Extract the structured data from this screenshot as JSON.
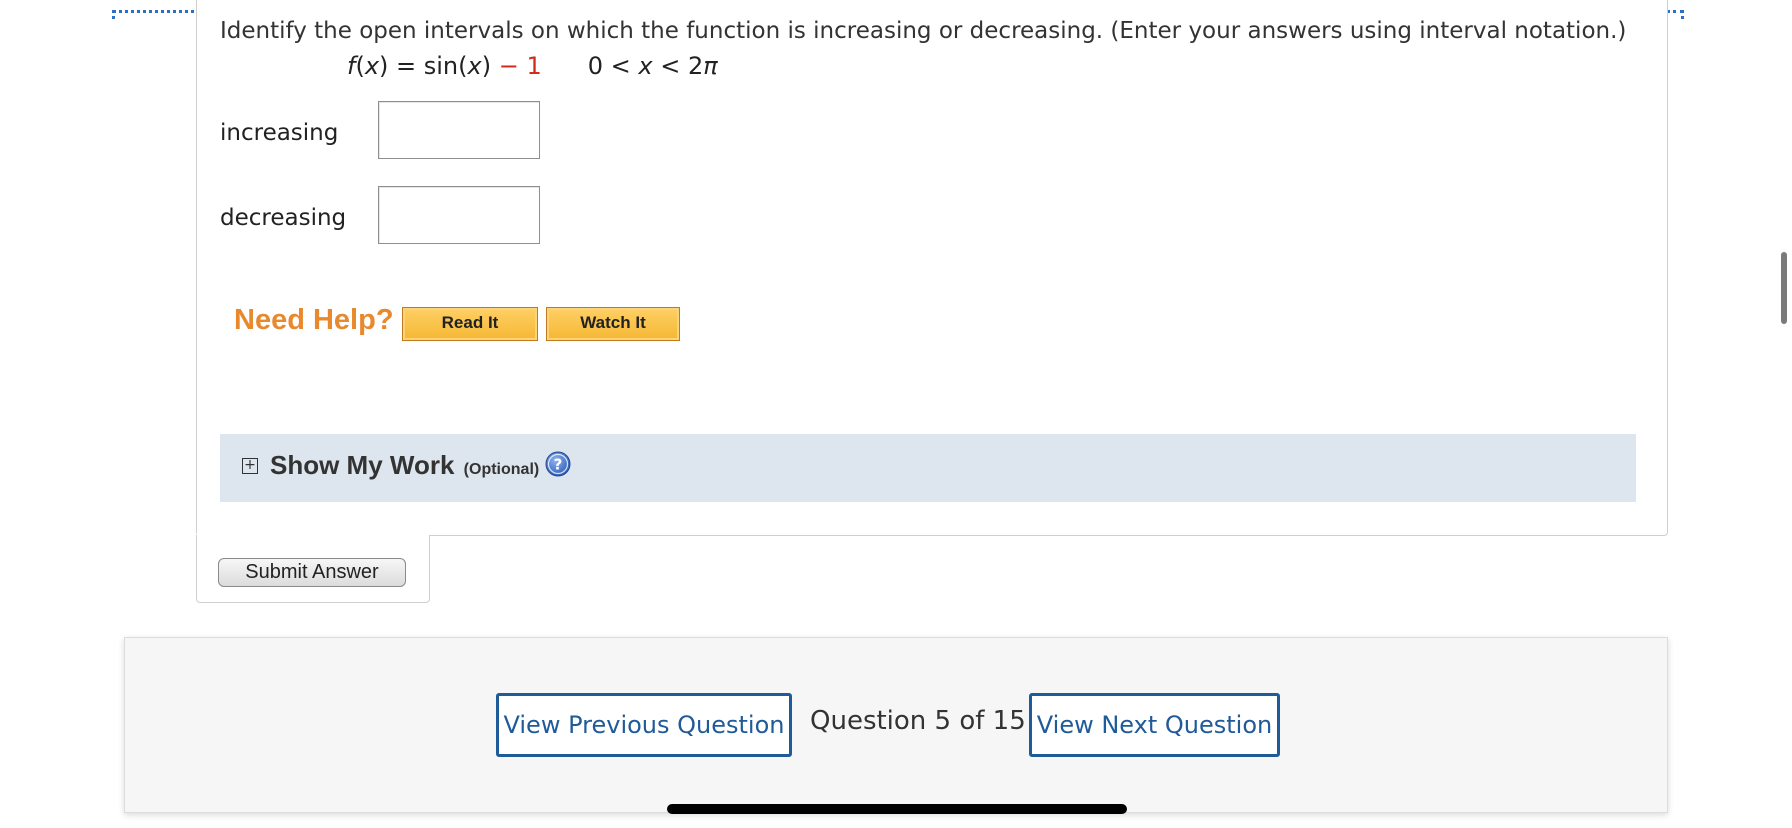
{
  "question": {
    "prompt": "Identify the open intervals on which the function is increasing or decreasing. (Enter your answers using interval notation.)",
    "formula": {
      "fx": "f",
      "open_paren": "(",
      "x": "x",
      "close_eq": ") = sin(",
      "x2": "x",
      "close": ")",
      "minus_one": " − 1",
      "domain_left": "0 < ",
      "domain_x": "x",
      "domain_right": " < 2",
      "domain_pi": "π"
    },
    "increasing_label": "increasing",
    "increasing_value": "",
    "decreasing_label": "decreasing",
    "decreasing_value": ""
  },
  "help": {
    "title": "Need Help?",
    "read_it": "Read It",
    "watch_it": "Watch It"
  },
  "show_work": {
    "expand_icon": "+",
    "title": "Show My Work",
    "optional": "(Optional)",
    "help_icon": "question-circle-icon"
  },
  "submit": {
    "label": "Submit Answer"
  },
  "navigation": {
    "previous": "View Previous Question",
    "counter": "Question 5 of 15",
    "next": "View Next Question"
  },
  "colors": {
    "link_blue": "#1f5a99",
    "need_help_orange": "#e8892e",
    "button_gold": "#f5b733",
    "show_work_bg": "#dde5ee",
    "minus_red": "#d42a1d"
  }
}
